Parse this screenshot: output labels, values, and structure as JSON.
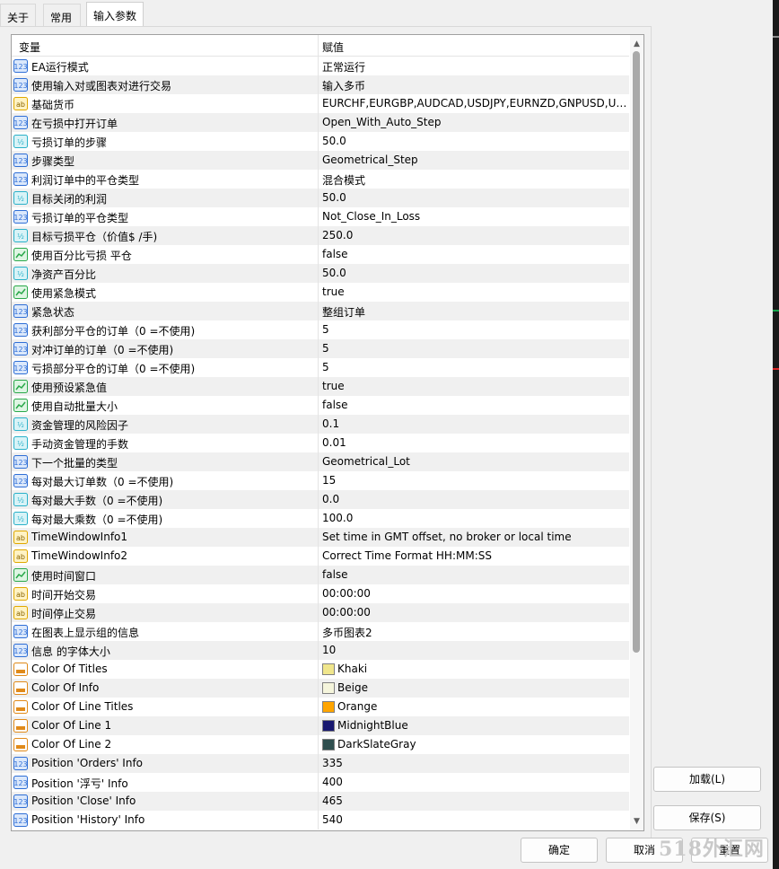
{
  "tabs": [
    {
      "label": "关于"
    },
    {
      "label": "常用"
    },
    {
      "label": "输入参数"
    }
  ],
  "grid": {
    "col_variable": "变量",
    "col_value": "赋值",
    "rows": [
      {
        "type": "int",
        "icon": "int-type-icon",
        "name": "EA运行模式",
        "value": "正常运行"
      },
      {
        "type": "int",
        "icon": "int-type-icon",
        "name": "使用输入对或图表对进行交易",
        "value": "输入多币"
      },
      {
        "type": "str",
        "icon": "string-type-icon",
        "name": "基础货币",
        "value": "EURCHF,EURGBP,AUDCAD,USDJPY,EURNZD,GNPUSD,US..."
      },
      {
        "type": "int",
        "icon": "int-type-icon",
        "name": "在亏损中打开订单",
        "value": "Open_With_Auto_Step"
      },
      {
        "type": "dbl",
        "icon": "double-type-icon",
        "name": "亏损订单的步骤",
        "value": "50.0"
      },
      {
        "type": "int",
        "icon": "int-type-icon",
        "name": "步骤类型",
        "value": "Geometrical_Step"
      },
      {
        "type": "int",
        "icon": "int-type-icon",
        "name": "利润订单中的平仓类型",
        "value": "混合模式"
      },
      {
        "type": "dbl",
        "icon": "double-type-icon",
        "name": "目标关闭的利润",
        "value": "50.0"
      },
      {
        "type": "int",
        "icon": "int-type-icon",
        "name": "亏损订单的平仓类型",
        "value": "Not_Close_In_Loss"
      },
      {
        "type": "dbl",
        "icon": "double-type-icon",
        "name": "目标亏损平仓（价值$ /手)",
        "value": "250.0"
      },
      {
        "type": "bool",
        "icon": "bool-type-icon",
        "name": "使用百分比亏损 平仓",
        "value": "false"
      },
      {
        "type": "dbl",
        "icon": "double-type-icon",
        "name": "净资产百分比",
        "value": "50.0"
      },
      {
        "type": "bool",
        "icon": "bool-type-icon",
        "name": "使用紧急模式",
        "value": "true"
      },
      {
        "type": "int",
        "icon": "int-type-icon",
        "name": "紧急状态",
        "value": "整组订单"
      },
      {
        "type": "int",
        "icon": "int-type-icon",
        "name": "获利部分平仓的订单（0 =不使用)",
        "value": "5"
      },
      {
        "type": "int",
        "icon": "int-type-icon",
        "name": "对冲订单的订单（0 =不使用)",
        "value": "5"
      },
      {
        "type": "int",
        "icon": "int-type-icon",
        "name": "亏损部分平仓的订单（0 =不使用)",
        "value": "5"
      },
      {
        "type": "bool",
        "icon": "bool-type-icon",
        "name": "使用预设紧急值",
        "value": "true"
      },
      {
        "type": "bool",
        "icon": "bool-type-icon",
        "name": "使用自动批量大小",
        "value": "false"
      },
      {
        "type": "dbl",
        "icon": "double-type-icon",
        "name": "资金管理的风险因子",
        "value": "0.1"
      },
      {
        "type": "dbl",
        "icon": "double-type-icon",
        "name": "手动资金管理的手数",
        "value": "0.01"
      },
      {
        "type": "int",
        "icon": "int-type-icon",
        "name": "下一个批量的类型",
        "value": "Geometrical_Lot"
      },
      {
        "type": "int",
        "icon": "int-type-icon",
        "name": "每对最大订单数（0 =不使用)",
        "value": "15"
      },
      {
        "type": "dbl",
        "icon": "double-type-icon",
        "name": "每对最大手数（0 =不使用)",
        "value": "0.0"
      },
      {
        "type": "dbl",
        "icon": "double-type-icon",
        "name": "每对最大乘数（0 =不使用)",
        "value": "100.0"
      },
      {
        "type": "str",
        "icon": "string-type-icon",
        "name": "TimeWindowInfo1",
        "value": "Set time in GMT offset, no broker or local time"
      },
      {
        "type": "str",
        "icon": "string-type-icon",
        "name": "TimeWindowInfo2",
        "value": "Correct Time Format HH:MM:SS"
      },
      {
        "type": "bool",
        "icon": "bool-type-icon",
        "name": "使用时间窗口",
        "value": "false"
      },
      {
        "type": "str",
        "icon": "string-type-icon",
        "name": "时间开始交易",
        "value": "00:00:00"
      },
      {
        "type": "str",
        "icon": "string-type-icon",
        "name": "时间停止交易",
        "value": "00:00:00"
      },
      {
        "type": "int",
        "icon": "int-type-icon",
        "name": "在图表上显示组的信息",
        "value": "多币图表2"
      },
      {
        "type": "int",
        "icon": "int-type-icon",
        "name": "信息 的字体大小",
        "value": "10"
      },
      {
        "type": "color",
        "icon": "color-type-icon",
        "name": "Color Of Titles",
        "value": "Khaki",
        "swatch": "#F0E68C"
      },
      {
        "type": "color",
        "icon": "color-type-icon",
        "name": "Color Of Info",
        "value": "Beige",
        "swatch": "#F5F5DC"
      },
      {
        "type": "color",
        "icon": "color-type-icon",
        "name": "Color Of Line Titles",
        "value": "Orange",
        "swatch": "#FFA500"
      },
      {
        "type": "color",
        "icon": "color-type-icon",
        "name": "Color Of Line 1",
        "value": "MidnightBlue",
        "swatch": "#191970"
      },
      {
        "type": "color",
        "icon": "color-type-icon",
        "name": "Color Of Line 2",
        "value": "DarkSlateGray",
        "swatch": "#2F4F4F"
      },
      {
        "type": "int",
        "icon": "int-type-icon",
        "name": "Position 'Orders' Info",
        "value": "335"
      },
      {
        "type": "int",
        "icon": "int-type-icon",
        "name": "Position '浮亏' Info",
        "value": "400"
      },
      {
        "type": "int",
        "icon": "int-type-icon",
        "name": "Position 'Close' Info",
        "value": "465"
      },
      {
        "type": "int",
        "icon": "int-type-icon",
        "name": "Position 'History' Info",
        "value": "540"
      }
    ]
  },
  "buttons": {
    "load": "加载(L)",
    "save": "保存(S)",
    "ok": "确定",
    "cancel": "取消",
    "reset": "重置"
  },
  "watermark": "518外汇网",
  "colors": {
    "int_icon": "#2f6fd6",
    "double_icon": "#2bb1c9",
    "string_icon": "#e0a800",
    "bool_icon": "#2aa84a",
    "color_icon": "#e08a1a"
  }
}
